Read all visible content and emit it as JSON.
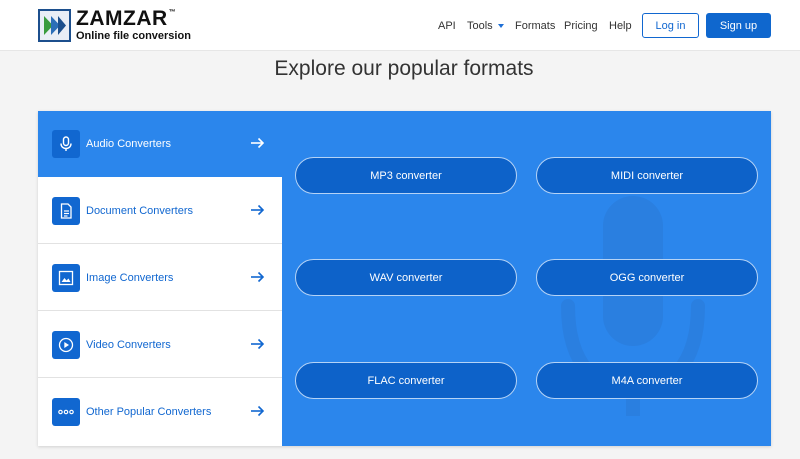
{
  "header": {
    "logo_name": "ZAMZAR",
    "logo_tm": "™",
    "logo_tagline": "Online file conversion",
    "nav": {
      "api": "API",
      "tools": "Tools",
      "formats": "Formats",
      "pricing": "Pricing",
      "help": "Help"
    },
    "login_label": "Log in",
    "signup_label": "Sign up"
  },
  "main": {
    "title": "Explore our popular formats",
    "categories": [
      {
        "label": "Audio Converters",
        "icon": "microphone-icon",
        "active": true
      },
      {
        "label": "Document Converters",
        "icon": "document-icon",
        "active": false
      },
      {
        "label": "Image Converters",
        "icon": "image-icon",
        "active": false
      },
      {
        "label": "Video Converters",
        "icon": "play-circle-icon",
        "active": false
      },
      {
        "label": "Other Popular Converters",
        "icon": "more-dots-icon",
        "active": false
      }
    ],
    "converters": [
      {
        "label": "MP3 converter"
      },
      {
        "label": "MIDI converter"
      },
      {
        "label": "WAV converter"
      },
      {
        "label": "OGG converter"
      },
      {
        "label": "FLAC converter"
      },
      {
        "label": "M4A converter"
      }
    ]
  },
  "colors": {
    "brand_blue": "#1167d0",
    "panel_blue": "#2b86ec",
    "button_blue": "#0d62c9",
    "page_bg": "#f4f4f4"
  }
}
